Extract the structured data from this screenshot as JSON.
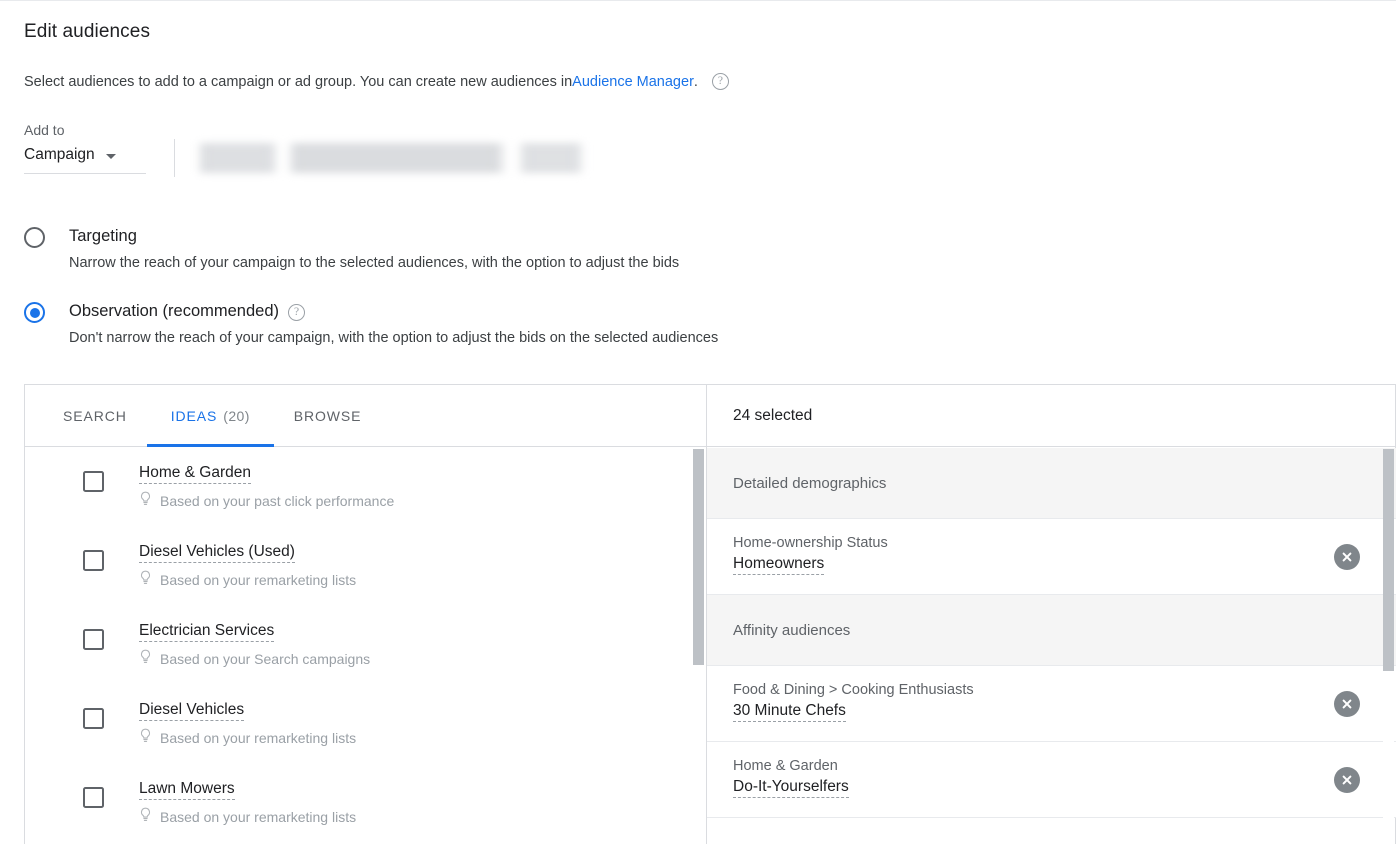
{
  "header": {
    "title": "Edit audiences",
    "subtitle_prefix": "Select audiences to add to a campaign or ad group. You can create new audiences in ",
    "subtitle_link": "Audience Manager",
    "subtitle_suffix": ".",
    "help_icon": "help-circle-icon"
  },
  "add_to": {
    "label": "Add to",
    "selected": "Campaign",
    "caret_icon": "chevron-down-icon",
    "campaign_value": ""
  },
  "modes": [
    {
      "id": "targeting",
      "label": "Targeting",
      "description": "Narrow the reach of your campaign to the selected audiences, with the option to adjust the bids",
      "selected": false,
      "has_help": false
    },
    {
      "id": "observation",
      "label": "Observation (recommended)",
      "description": "Don't narrow the reach of your campaign, with the option to adjust the bids on the selected audiences",
      "selected": true,
      "has_help": true
    }
  ],
  "tabs": [
    {
      "label": "SEARCH",
      "count": "",
      "active": false
    },
    {
      "label": "IDEAS",
      "count": "(20)",
      "active": true
    },
    {
      "label": "BROWSE",
      "count": "",
      "active": false
    }
  ],
  "ideas": [
    {
      "name": "Home & Garden",
      "source": "Based on your past click performance",
      "checked": false
    },
    {
      "name": "Diesel Vehicles (Used)",
      "source": "Based on your remarketing lists",
      "checked": false
    },
    {
      "name": "Electrician Services",
      "source": "Based on your Search campaigns",
      "checked": false
    },
    {
      "name": "Diesel Vehicles",
      "source": "Based on your remarketing lists",
      "checked": false
    },
    {
      "name": "Lawn Mowers",
      "source": "Based on your remarketing lists",
      "checked": false
    }
  ],
  "selected_panel": {
    "count_label": "24 selected",
    "groups": [
      {
        "title": "Detailed demographics",
        "items": [
          {
            "category": "Home-ownership Status",
            "name": "Homeowners",
            "remove_icon": "close-circle-icon"
          }
        ]
      },
      {
        "title": "Affinity audiences",
        "items": [
          {
            "category": "Food & Dining > Cooking Enthusiasts",
            "name": "30 Minute Chefs",
            "remove_icon": "close-circle-icon"
          },
          {
            "category": "Home & Garden",
            "name": "Do-It-Yourselfers",
            "remove_icon": "close-circle-icon"
          }
        ]
      }
    ]
  },
  "colors": {
    "accent": "#1a73e8",
    "text_primary": "#202124",
    "text_secondary": "#5f6368",
    "text_muted": "#9aa0a6",
    "border": "#dadce0",
    "group_bg": "#f5f5f5"
  }
}
